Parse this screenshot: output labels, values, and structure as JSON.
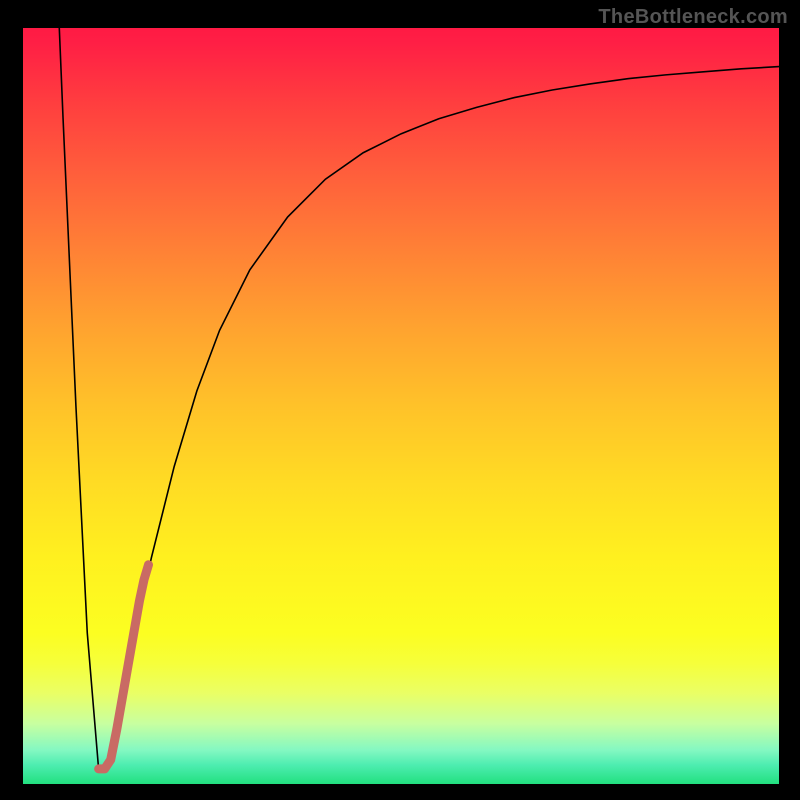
{
  "watermark": "TheBottleneck.com",
  "colors": {
    "background": "#000000",
    "gradient_stops": [
      {
        "offset": 0.0,
        "color": "#ff1a44"
      },
      {
        "offset": 0.02,
        "color": "#ff1f45"
      },
      {
        "offset": 0.1,
        "color": "#ff3e3f"
      },
      {
        "offset": 0.2,
        "color": "#ff613b"
      },
      {
        "offset": 0.3,
        "color": "#ff8335"
      },
      {
        "offset": 0.4,
        "color": "#ffa42f"
      },
      {
        "offset": 0.5,
        "color": "#ffc229"
      },
      {
        "offset": 0.6,
        "color": "#ffdb24"
      },
      {
        "offset": 0.7,
        "color": "#fff01f"
      },
      {
        "offset": 0.8,
        "color": "#fcfe21"
      },
      {
        "offset": 0.84,
        "color": "#f6ff3a"
      },
      {
        "offset": 0.88,
        "color": "#eaff65"
      },
      {
        "offset": 0.92,
        "color": "#c8ffa0"
      },
      {
        "offset": 0.955,
        "color": "#84f8c2"
      },
      {
        "offset": 0.975,
        "color": "#4dedb0"
      },
      {
        "offset": 1.0,
        "color": "#22e07f"
      }
    ],
    "curve": "#000000",
    "highlight": "#c96a64"
  },
  "chart_data": {
    "type": "line",
    "title": "",
    "xlabel": "",
    "ylabel": "",
    "xlim": [
      0,
      100
    ],
    "ylim": [
      0,
      100
    ],
    "series": [
      {
        "name": "bottleneck-curve",
        "x": [
          4.8,
          5.3,
          7.0,
          8.5,
          10.0,
          11.5,
          13.0,
          14.5,
          17.0,
          20.0,
          23.0,
          26.0,
          30.0,
          35.0,
          40.0,
          45.0,
          50.0,
          55.0,
          60.0,
          65.0,
          70.0,
          75.0,
          80.0,
          85.0,
          90.0,
          95.0,
          100.0
        ],
        "y": [
          100.0,
          88.0,
          50.0,
          20.0,
          2.0,
          3.0,
          10.0,
          19.0,
          30.0,
          42.0,
          52.0,
          60.0,
          68.0,
          75.0,
          80.0,
          83.5,
          86.0,
          88.0,
          89.5,
          90.8,
          91.8,
          92.6,
          93.3,
          93.8,
          94.2,
          94.6,
          94.9
        ]
      },
      {
        "name": "highlight-segment",
        "x": [
          10.0,
          10.8,
          11.6,
          12.4,
          13.0,
          13.6,
          14.2,
          14.8,
          15.4,
          16.0,
          16.6
        ],
        "y": [
          2.0,
          2.0,
          3.2,
          7.2,
          10.6,
          14.0,
          17.4,
          20.8,
          24.2,
          27.0,
          29.0
        ]
      }
    ],
    "annotations": []
  }
}
